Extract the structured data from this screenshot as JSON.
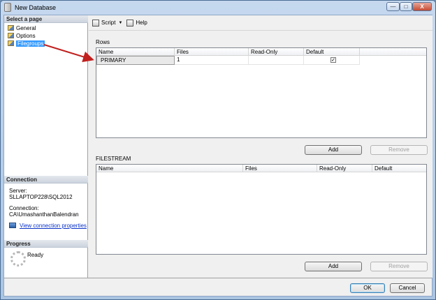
{
  "window": {
    "title": "New Database",
    "minimize_glyph": "—",
    "maximize_glyph": "□",
    "close_glyph": "X"
  },
  "left": {
    "select_page_header": "Select a page",
    "pages": [
      {
        "label": "General"
      },
      {
        "label": "Options"
      },
      {
        "label": "Filegroups",
        "selected": true
      }
    ],
    "connection_header": "Connection",
    "server_label": "Server:",
    "server_value": "SLLAPTOP228\\SQL2012",
    "connection_label": "Connection:",
    "connection_value": "CA\\UmashanthanBalendran",
    "view_props_link": "View connection properties",
    "progress_header": "Progress",
    "progress_status": "Ready"
  },
  "toolbar": {
    "script_label": "Script",
    "script_caret": "▼",
    "help_label": "Help"
  },
  "rows_group": {
    "label": "Rows",
    "columns": [
      "Name",
      "Files",
      "Read-Only",
      "Default"
    ],
    "rows": [
      {
        "name": "PRIMARY",
        "files": "1",
        "readonly": "",
        "default_check": "✓"
      }
    ],
    "add_label": "Add",
    "remove_label": "Remove"
  },
  "filestream_group": {
    "label": "FILESTREAM",
    "columns": [
      "Name",
      "Files",
      "Read-Only",
      "Default"
    ],
    "add_label": "Add",
    "remove_label": "Remove"
  },
  "footer": {
    "ok_label": "OK",
    "cancel_label": "Cancel"
  },
  "colors": {
    "selection": "#3399ff",
    "link": "#0a33c8",
    "arrow": "#c0201e"
  }
}
